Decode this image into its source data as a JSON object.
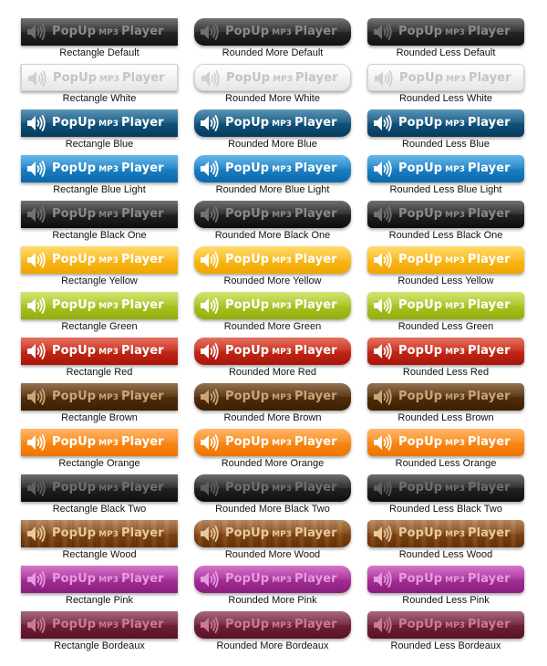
{
  "button_text": {
    "popup": "PopUp",
    "mp3": "MP3",
    "player": "Player"
  },
  "shapes": [
    "rect",
    "more",
    "less"
  ],
  "rows": [
    {
      "colors": {
        "top": "#3b3b3b",
        "bottom": "#111111",
        "text": "#8a8a8a",
        "icon": "#6f6f6f",
        "wood": false
      },
      "labels": [
        "Rectangle Default",
        "Rounded More Default",
        "Rounded Less Default"
      ]
    },
    {
      "colors": {
        "top": "#ffffff",
        "bottom": "#e6e6e6",
        "text": "#c4c4c4",
        "icon": "#cfcfcf",
        "wood": false
      },
      "labels": [
        "Rectangle White",
        "Rounded More White",
        "Rounded Less White"
      ]
    },
    {
      "colors": {
        "top": "#1a6b9a",
        "bottom": "#063a5c",
        "text": "#ffffff",
        "icon": "#ffffff",
        "wood": false
      },
      "labels": [
        "Rectangle Blue",
        "Rounded More Blue",
        "Rounded Less Blue"
      ]
    },
    {
      "colors": {
        "top": "#2f9ae0",
        "bottom": "#0a67aa",
        "text": "#ffffff",
        "icon": "#ffffff",
        "wood": false
      },
      "labels": [
        "Rectangle Blue Light",
        "Rounded More Blue Light",
        "Rounded Less Blue Light"
      ]
    },
    {
      "colors": {
        "top": "#3a3a3a",
        "bottom": "#0c0c0c",
        "text": "#8a8a8a",
        "icon": "#727272",
        "wood": false
      },
      "labels": [
        "Rectangle Black One",
        "Rounded More Black One",
        "Rounded Less Black One"
      ]
    },
    {
      "colors": {
        "top": "#ffcc33",
        "bottom": "#f0a500",
        "text": "#ffffff",
        "icon": "#ffffff",
        "wood": false
      },
      "labels": [
        "Rectangle Yellow",
        "Rounded More Yellow",
        "Rounded Less Yellow"
      ]
    },
    {
      "colors": {
        "top": "#c2d93a",
        "bottom": "#8fae0c",
        "text": "#ffffff",
        "icon": "#ffffff",
        "wood": false
      },
      "labels": [
        "Rectangle Green",
        "Rounded More Green",
        "Rounded Less Green"
      ]
    },
    {
      "colors": {
        "top": "#dd3a22",
        "bottom": "#a8150a",
        "text": "#ffffff",
        "icon": "#ffffff",
        "wood": false
      },
      "labels": [
        "Rectangle Red",
        "Rounded More Red",
        "Rounded Less Red"
      ]
    },
    {
      "colors": {
        "top": "#6a3d10",
        "bottom": "#3b1f05",
        "text": "#c9a57c",
        "icon": "#c9a57c",
        "wood": false
      },
      "labels": [
        "Rectangle Brown",
        "Rounded More Brown",
        "Rounded Less Brown"
      ]
    },
    {
      "colors": {
        "top": "#ff9a2e",
        "bottom": "#f07400",
        "text": "#ffffff",
        "icon": "#ffffff",
        "wood": false
      },
      "labels": [
        "Rectangle Orange",
        "Rounded More Orange",
        "Rounded Less Orange"
      ]
    },
    {
      "colors": {
        "top": "#363636",
        "bottom": "#0e0e0e",
        "text": "#6e6e6e",
        "icon": "#5e5e5e",
        "wood": false
      },
      "labels": [
        "Rectangle Black Two",
        "Rounded More Black Two",
        "Rounded Less Black Two"
      ]
    },
    {
      "colors": {
        "top": "#a05c1e",
        "bottom": "#6b3507",
        "text": "#e7c9a0",
        "icon": "#e7c9a0",
        "wood": true
      },
      "labels": [
        "Rectangle Wood",
        "Rounded More Wood",
        "Rounded Less Wood"
      ]
    },
    {
      "colors": {
        "top": "#c43fb5",
        "bottom": "#861e7a",
        "text": "#e79bdf",
        "icon": "#e79bdf",
        "wood": false
      },
      "labels": [
        "Rectangle Pink",
        "Rounded More Pink",
        "Rounded Less Pink"
      ]
    },
    {
      "colors": {
        "top": "#84304a",
        "bottom": "#5a1126",
        "text": "#c97c93",
        "icon": "#c97c93",
        "wood": false
      },
      "labels": [
        "Rectangle Bordeaux",
        "Rounded More Bordeaux",
        "Rounded Less Bordeaux"
      ]
    }
  ]
}
